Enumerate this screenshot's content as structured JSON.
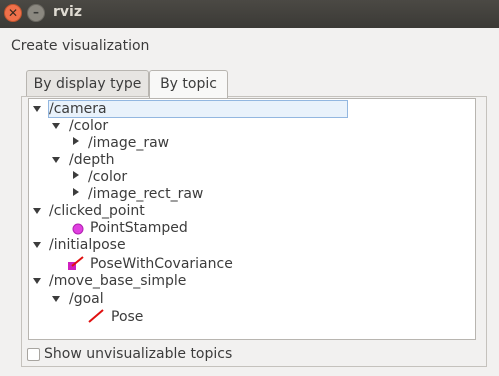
{
  "window": {
    "title": "rviz",
    "close_glyph": "✕",
    "minimize_glyph": "–"
  },
  "dialog": {
    "heading": "Create visualization"
  },
  "tabs": [
    {
      "label": "By display type",
      "active": false
    },
    {
      "label": "By topic",
      "active": true
    }
  ],
  "tree": {
    "nodes": [
      {
        "label": "/camera",
        "expand": "expanded",
        "selected": true
      },
      {
        "label": "/color",
        "expand": "expanded"
      },
      {
        "label": "/image_raw",
        "expand": "collapsed"
      },
      {
        "label": "/depth",
        "expand": "expanded"
      },
      {
        "label": "/color",
        "expand": "collapsed"
      },
      {
        "label": "/image_rect_raw",
        "expand": "collapsed"
      },
      {
        "label": "/clicked_point",
        "expand": "expanded"
      },
      {
        "label": "PointStamped",
        "icon": "point-icon"
      },
      {
        "label": "/initialpose",
        "expand": "expanded"
      },
      {
        "label": "PoseWithCovariance",
        "icon": "pose-with-covariance-icon"
      },
      {
        "label": "/move_base_simple",
        "expand": "expanded"
      },
      {
        "label": "/goal",
        "expand": "expanded"
      },
      {
        "label": "Pose",
        "icon": "pose-arrow-icon"
      }
    ]
  },
  "options": {
    "show_unvisualizable_label": "Show unvisualizable topics",
    "show_unvisualizable_checked": false
  },
  "colors": {
    "point_icon": "#e040e0",
    "pose_arrow": "#e01010",
    "covariance_square": "#d020c0",
    "selection_border": "#93b7e0"
  }
}
